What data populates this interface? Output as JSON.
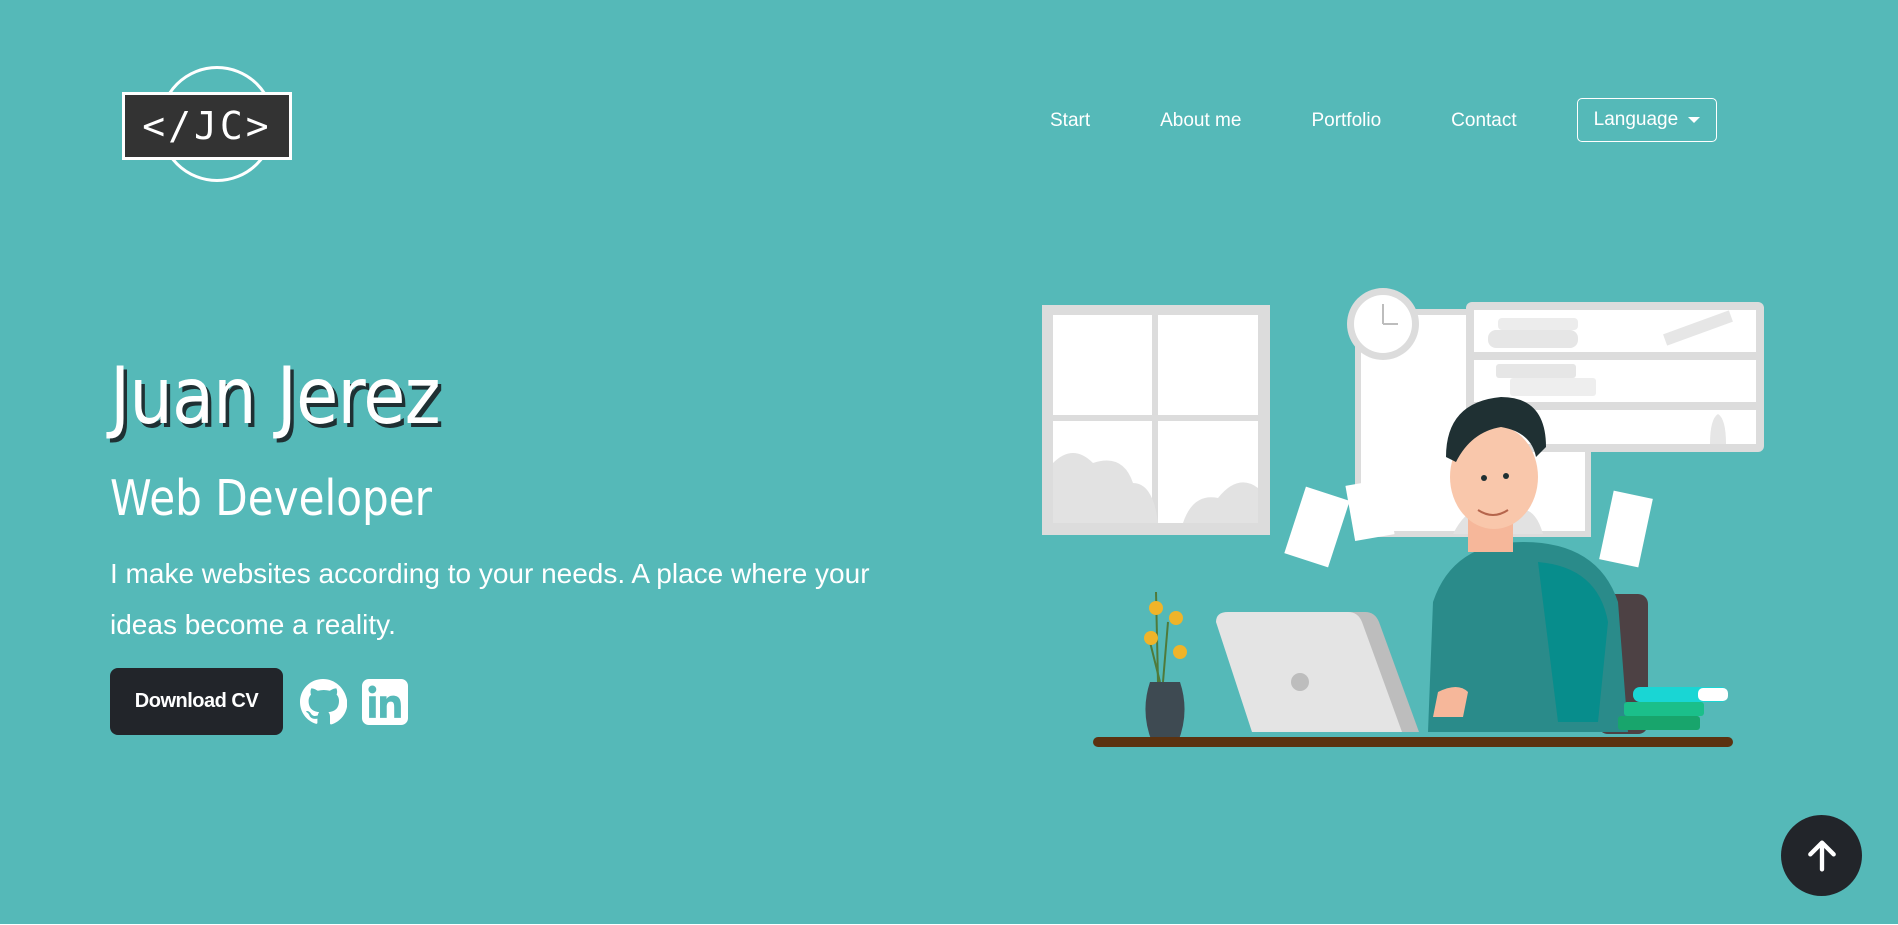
{
  "logo": {
    "text": "</JC>"
  },
  "nav": {
    "items": [
      {
        "label": "Start"
      },
      {
        "label": "About me"
      },
      {
        "label": "Portfolio"
      },
      {
        "label": "Contact"
      }
    ],
    "language": {
      "label": "Language"
    }
  },
  "hero": {
    "name": "Juan Jerez",
    "role": "Web Developer",
    "tagline": "I make websites according to your needs. A place where your ideas become a reality.",
    "cv_button": "Download CV",
    "social": [
      {
        "icon": "github-icon"
      },
      {
        "icon": "linkedin-icon"
      }
    ]
  },
  "colors": {
    "background": "#55b9b8",
    "button_dark": "#22252a",
    "logo_box": "#333333",
    "shirt": "#2a8b8a"
  },
  "scroll_top": {
    "icon": "arrow-up-icon"
  }
}
